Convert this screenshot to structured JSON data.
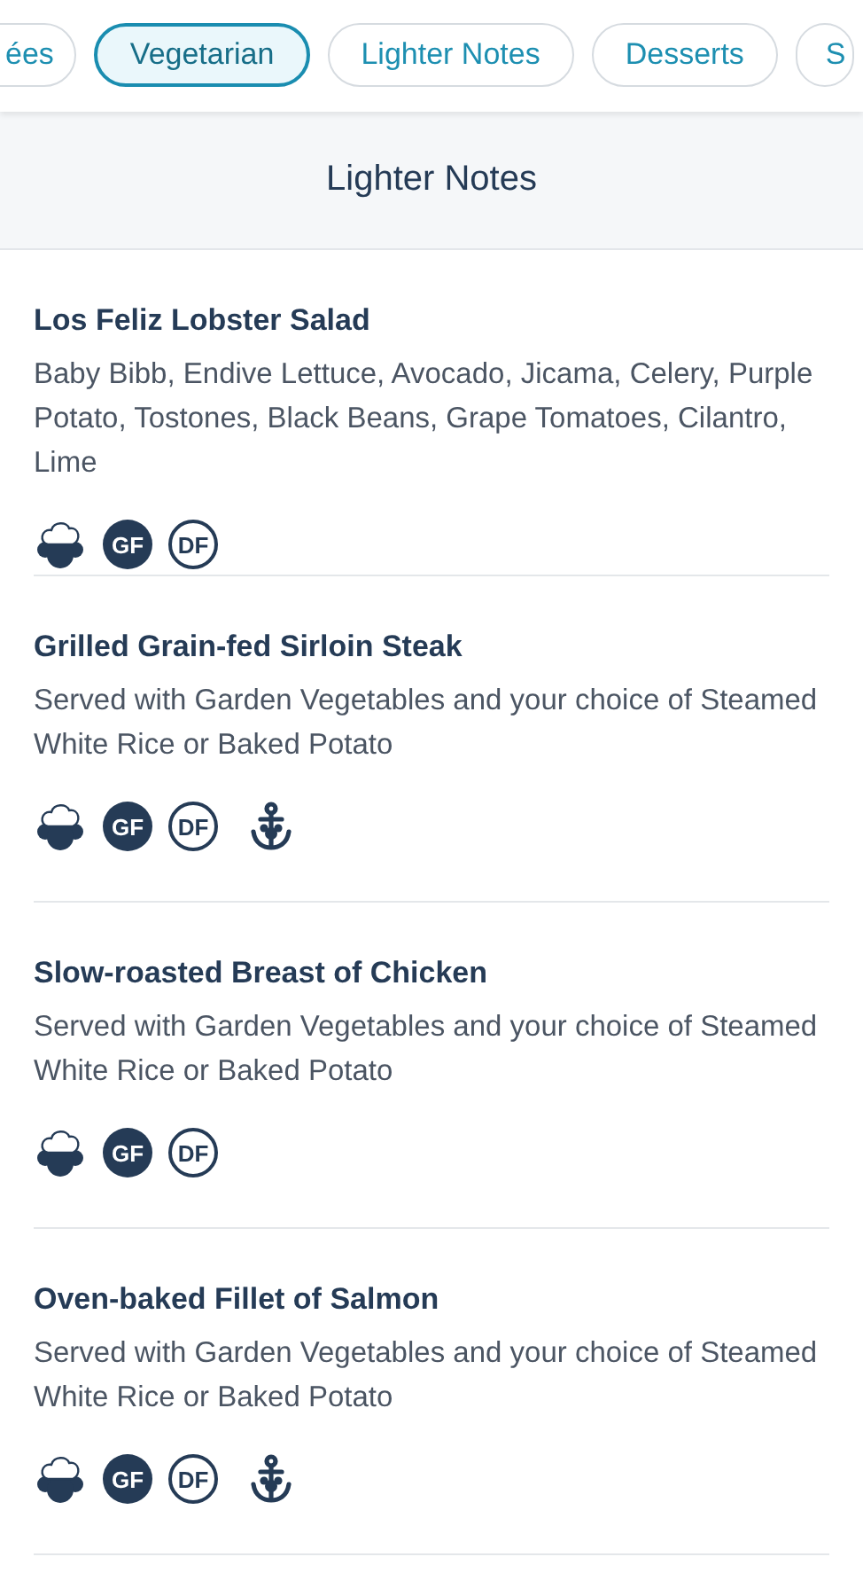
{
  "filter_chips": [
    {
      "label": "ées",
      "selected": false
    },
    {
      "label": "Vegetarian",
      "selected": true
    },
    {
      "label": "Lighter Notes",
      "selected": false
    },
    {
      "label": "Desserts",
      "selected": false
    },
    {
      "label": "S",
      "selected": false
    }
  ],
  "section_title": "Lighter Notes",
  "menu_items": [
    {
      "name": "Los Feliz Lobster Salad",
      "description": "Baby Bibb, Endive Lettuce, Avocado, Jicama, Celery, Purple Potato, Tostones, Black Beans, Grape Tomatoes, Cilantro, Lime",
      "badges": [
        {
          "kind": "chef"
        },
        {
          "kind": "gf",
          "text": "GF"
        },
        {
          "kind": "df",
          "text": "DF"
        }
      ]
    },
    {
      "name": "Grilled Grain-fed Sirloin Steak",
      "description": "Served with Garden Vegetables and your choice of Steamed White Rice or Baked Potato",
      "badges": [
        {
          "kind": "chef"
        },
        {
          "kind": "gf",
          "text": "GF"
        },
        {
          "kind": "df",
          "text": "DF"
        },
        {
          "kind": "anchor"
        }
      ]
    },
    {
      "name": "Slow-roasted Breast of Chicken",
      "description": "Served with Garden Vegetables and your choice of Steamed White Rice or Baked Potato",
      "badges": [
        {
          "kind": "chef"
        },
        {
          "kind": "gf",
          "text": "GF"
        },
        {
          "kind": "df",
          "text": "DF"
        }
      ]
    },
    {
      "name": "Oven-baked Fillet of Salmon",
      "description": "Served with Garden Vegetables and your choice of Steamed White Rice or Baked Potato",
      "badges": [
        {
          "kind": "chef"
        },
        {
          "kind": "gf",
          "text": "GF"
        },
        {
          "kind": "df",
          "text": "DF"
        },
        {
          "kind": "anchor"
        }
      ]
    }
  ]
}
